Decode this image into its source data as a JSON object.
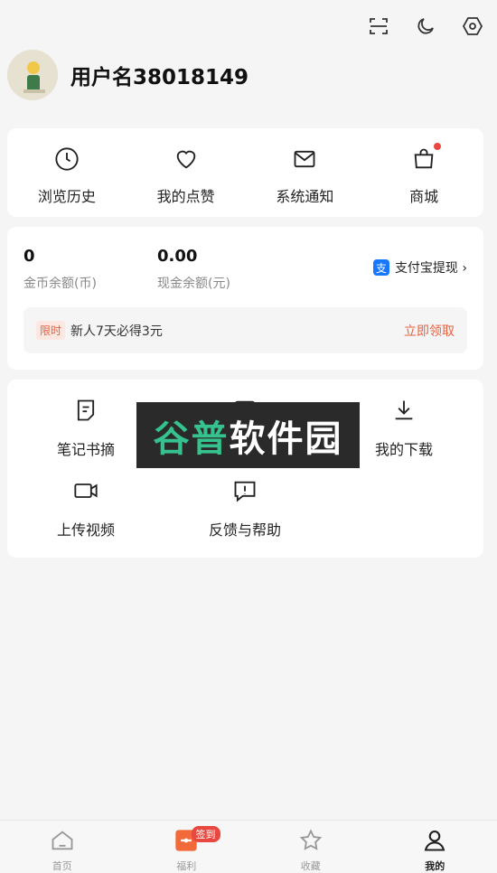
{
  "header": {
    "icons": [
      "scan-icon",
      "moon-icon",
      "settings-icon"
    ],
    "username": "用户名38018149"
  },
  "quick_actions": [
    {
      "label": "浏览历史",
      "icon": "clock-icon"
    },
    {
      "label": "我的点赞",
      "icon": "heart-icon"
    },
    {
      "label": "系统通知",
      "icon": "mail-icon"
    },
    {
      "label": "商城",
      "icon": "shopping-bag-icon",
      "has_dot": true
    }
  ],
  "wallet": {
    "coins_value": "0",
    "coins_label": "金币余额(币)",
    "cash_value": "0.00",
    "cash_label": "现金余额(元)",
    "alipay_icon_text": "支",
    "alipay_label": "支付宝提现 ›",
    "promo_tag": "限时",
    "promo_text": "新人7天必得3元",
    "promo_action": "立即领取"
  },
  "grid_items": [
    {
      "label": "笔记书摘",
      "icon": "note-icon"
    },
    {
      "label": "",
      "icon": "video-play-icon"
    },
    {
      "label": "我的下载",
      "icon": "download-icon"
    },
    {
      "label": "上传视频",
      "icon": "camera-icon"
    },
    {
      "label": "反馈与帮助",
      "icon": "feedback-icon"
    }
  ],
  "watermark": {
    "part1": "谷普",
    "part2": "软件园"
  },
  "tabbar": [
    {
      "label": "首页",
      "icon": "home-icon"
    },
    {
      "label": "福利",
      "icon": "gift-icon",
      "badge": "签到"
    },
    {
      "label": "收藏",
      "icon": "star-icon"
    },
    {
      "label": "我的",
      "icon": "user-icon",
      "active": true
    }
  ],
  "colors": {
    "accent": "#e8613f",
    "badge": "#e8483f",
    "alipay": "#1677ff"
  }
}
